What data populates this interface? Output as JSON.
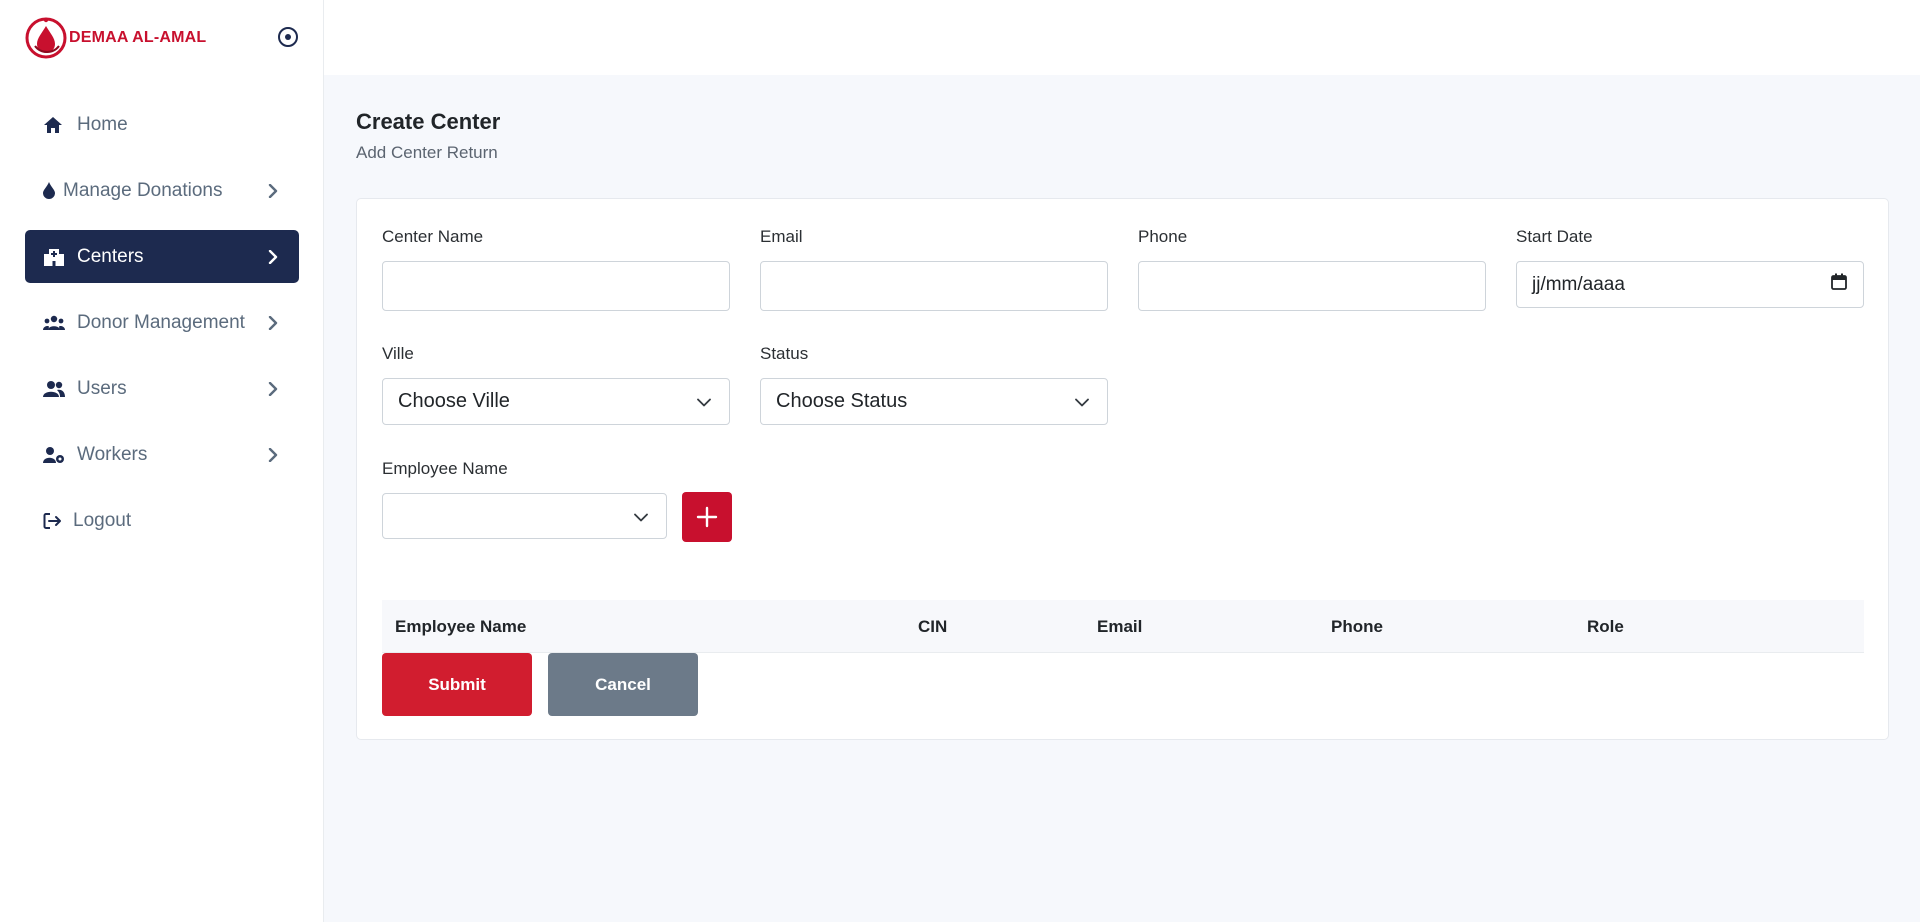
{
  "brand": {
    "name": "DEMAA AL-AMAL"
  },
  "sidebar": {
    "items": [
      {
        "label": "Home",
        "icon": "home-icon",
        "has_chevron": false,
        "active": false
      },
      {
        "label": "Manage Donations",
        "icon": "drop-icon",
        "has_chevron": true,
        "active": false
      },
      {
        "label": "Centers",
        "icon": "hospital-icon",
        "has_chevron": true,
        "active": true
      },
      {
        "label": "Donor Management",
        "icon": "users-group-icon",
        "has_chevron": true,
        "active": false
      },
      {
        "label": "Users",
        "icon": "users-icon",
        "has_chevron": true,
        "active": false
      },
      {
        "label": "Workers",
        "icon": "user-gear-icon",
        "has_chevron": true,
        "active": false
      },
      {
        "label": "Logout",
        "icon": "logout-icon",
        "has_chevron": false,
        "active": false
      }
    ]
  },
  "page": {
    "title": "Create Center",
    "subtitle": "Add Center Return"
  },
  "form": {
    "center_name": {
      "label": "Center Name",
      "value": ""
    },
    "email": {
      "label": "Email",
      "value": ""
    },
    "phone": {
      "label": "Phone",
      "value": ""
    },
    "start_date": {
      "label": "Start Date",
      "placeholder": "jj/mm/aaaa"
    },
    "ville": {
      "label": "Ville",
      "selected": "Choose Ville"
    },
    "status": {
      "label": "Status",
      "selected": "Choose Status"
    },
    "employee": {
      "label": "Employee Name",
      "selected": ""
    }
  },
  "table": {
    "columns": [
      "Employee Name",
      "CIN",
      "Email",
      "Phone",
      "Role"
    ],
    "rows": []
  },
  "actions": {
    "submit": "Submit",
    "cancel": "Cancel"
  },
  "colors": {
    "brand": "#c8102e",
    "active_nav": "#1d2a4f",
    "submit": "#d11d2f",
    "cancel": "#6c7a89"
  }
}
